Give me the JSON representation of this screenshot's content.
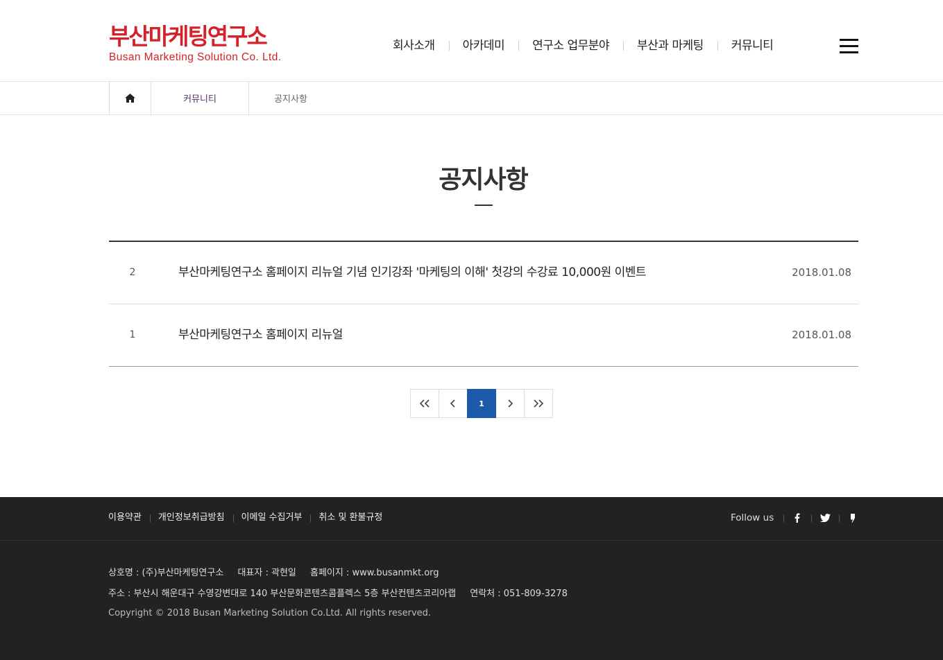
{
  "header": {
    "logo_ko": "부산마케팅연구소",
    "logo_en": "Busan  Marketing  Solution Co. Ltd.",
    "nav": [
      {
        "label": "회사소개"
      },
      {
        "label": "아카데미"
      },
      {
        "label": "연구소 업무분야"
      },
      {
        "label": "부산과 마케팅"
      },
      {
        "label": "커뮤니티"
      }
    ],
    "menu_icon": "hamburger-menu-icon"
  },
  "breadcrumb": {
    "home_icon": "home-icon",
    "level1": "커뮤니티",
    "level2": "공지사항"
  },
  "page": {
    "title": "공지사항"
  },
  "notices": [
    {
      "num": "2",
      "title": "부산마케팅연구소 홈페이지 리뉴얼 기념 인기강좌 '마케팅의 이해' 첫강의 수강료 10,000원 이벤트",
      "date": "2018.01.08"
    },
    {
      "num": "1",
      "title": "부산마케팅연구소 홈페이지 리뉴얼",
      "date": "2018.01.08"
    }
  ],
  "pagination": {
    "first": "«",
    "prev": "‹",
    "current": "1",
    "next": "›",
    "last": "»"
  },
  "footer": {
    "links": [
      {
        "label": "이용약관"
      },
      {
        "label": "개인정보취급방침"
      },
      {
        "label": "이메일 수집거부"
      },
      {
        "label": "취소 및 환불규정"
      }
    ],
    "follow_label": "Follow us",
    "sns": [
      "facebook-icon",
      "twitter-icon",
      "kakaostory-icon"
    ],
    "company": "상호명 : (주)부산마케팅연구소",
    "ceo": "대표자 : 곽현일",
    "homepage": "홈페이지 : www.busanmkt.org",
    "address": "주소 : 부산시 해운대구 수영강변대로 140 부산문화콘텐츠콤플렉스 5층 부산컨텐츠코리아랩",
    "contact": "연락처 : 051-809-3278",
    "copyright": "Copyright © 2018 Busan Marketing Solution Co.Ltd. All rights reserved."
  },
  "colors": {
    "brand_red": "#d4212a",
    "pager_active": "#1a5aa8",
    "footer_bg": "#222222"
  }
}
